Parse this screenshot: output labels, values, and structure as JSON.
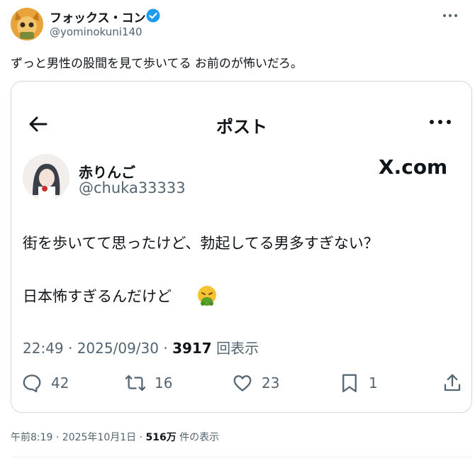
{
  "author": {
    "name": "フォックス・コン",
    "handle": "@yominokuni140",
    "verified": true
  },
  "post": {
    "text": "ずっと男性の股間を見て歩いてる お前のが怖いだろ。"
  },
  "embedded": {
    "nav_title": "ポスト",
    "name": "赤りんご",
    "handle": "@chuka33333",
    "watermark": "X.com",
    "line1": "街を歩いてて思ったけど、勃起してる男多すぎない？",
    "line2": "日本怖すぎるんだけど",
    "time": "22:49 · 2025/09/30 · ",
    "views_count": "3917",
    "views_label": "回表示",
    "replies": "42",
    "reposts": "16",
    "likes": "23",
    "bookmarks": "1"
  },
  "footer": {
    "time": "午前8:19 · 2025年10月1日 · ",
    "views_count": "516万",
    "views_label": " 件の表示"
  },
  "colors": {
    "text": "#0f1419",
    "secondary": "#536471",
    "verified": "#1d9bf0",
    "border": "#cfd9de",
    "avatar_bg": "#e8a33a"
  },
  "icons": [
    "back-arrow-icon",
    "more-icon",
    "verified-icon",
    "reply-icon",
    "repost-icon",
    "like-icon",
    "bookmark-icon",
    "share-icon",
    "nauseated-emoji"
  ]
}
